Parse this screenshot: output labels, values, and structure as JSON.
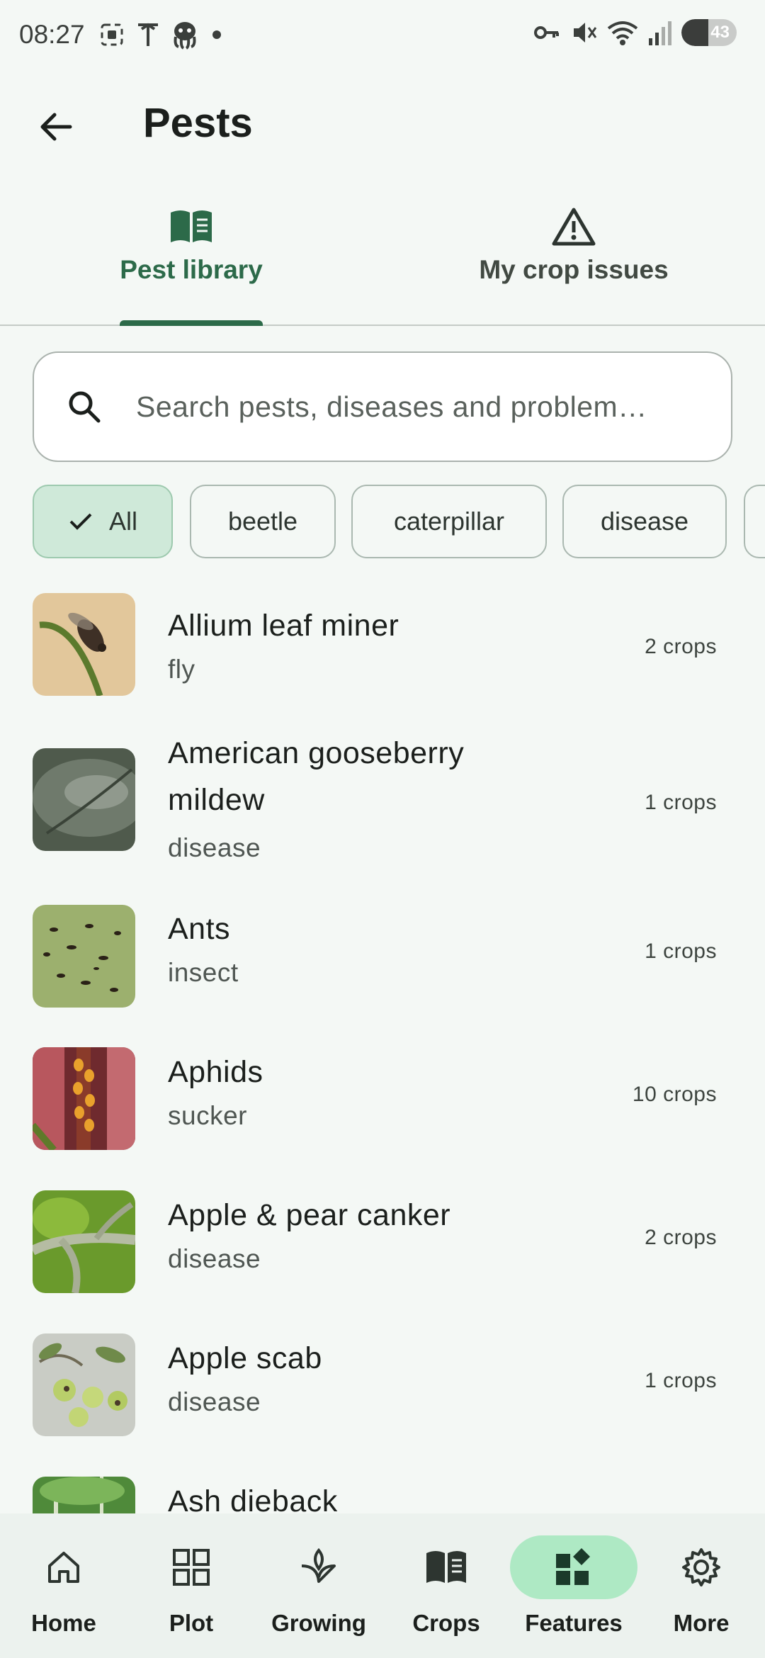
{
  "status_bar": {
    "time": "08:27",
    "battery": "43"
  },
  "app_bar": {
    "title": "Pests",
    "back_icon": "arrow-left-icon"
  },
  "tabs": [
    {
      "label": "Pest library",
      "icon": "book-icon",
      "selected": true
    },
    {
      "label": "My crop issues",
      "icon": "warning-triangle-icon",
      "selected": false
    }
  ],
  "search": {
    "placeholder": "Search pests, diseases and problem…"
  },
  "chips": [
    {
      "label": "All",
      "selected": true
    },
    {
      "label": "beetle",
      "selected": false
    },
    {
      "label": "caterpillar",
      "selected": false
    },
    {
      "label": "disease",
      "selected": false
    }
  ],
  "pests": [
    {
      "name": "Allium leaf miner",
      "type": "fly",
      "crops": "2 crops"
    },
    {
      "name_line1": "American gooseberry",
      "name_line2": "mildew",
      "type": "disease",
      "crops": "1 crops"
    },
    {
      "name": "Ants",
      "type": "insect",
      "crops": "1 crops"
    },
    {
      "name": "Aphids",
      "type": "sucker",
      "crops": "10 crops"
    },
    {
      "name": "Apple & pear canker",
      "type": "disease",
      "crops": "2 crops"
    },
    {
      "name": "Apple scab",
      "type": "disease",
      "crops": "1 crops"
    },
    {
      "name": "Ash dieback",
      "type": "",
      "crops": ""
    }
  ],
  "bottom_nav": [
    {
      "label": "Home",
      "icon": "home-icon"
    },
    {
      "label": "Plot",
      "icon": "grid-icon"
    },
    {
      "label": "Growing",
      "icon": "sprout-icon"
    },
    {
      "label": "Crops",
      "icon": "book-icon"
    },
    {
      "label": "Features",
      "icon": "features-icon",
      "active": true
    },
    {
      "label": "More",
      "icon": "gear-icon"
    }
  ],
  "colors": {
    "background": "#f4f8f5",
    "accent": "#2c6a49",
    "chip_selected": "#cfe9d9",
    "nav_active_pill": "#aee9c4"
  }
}
